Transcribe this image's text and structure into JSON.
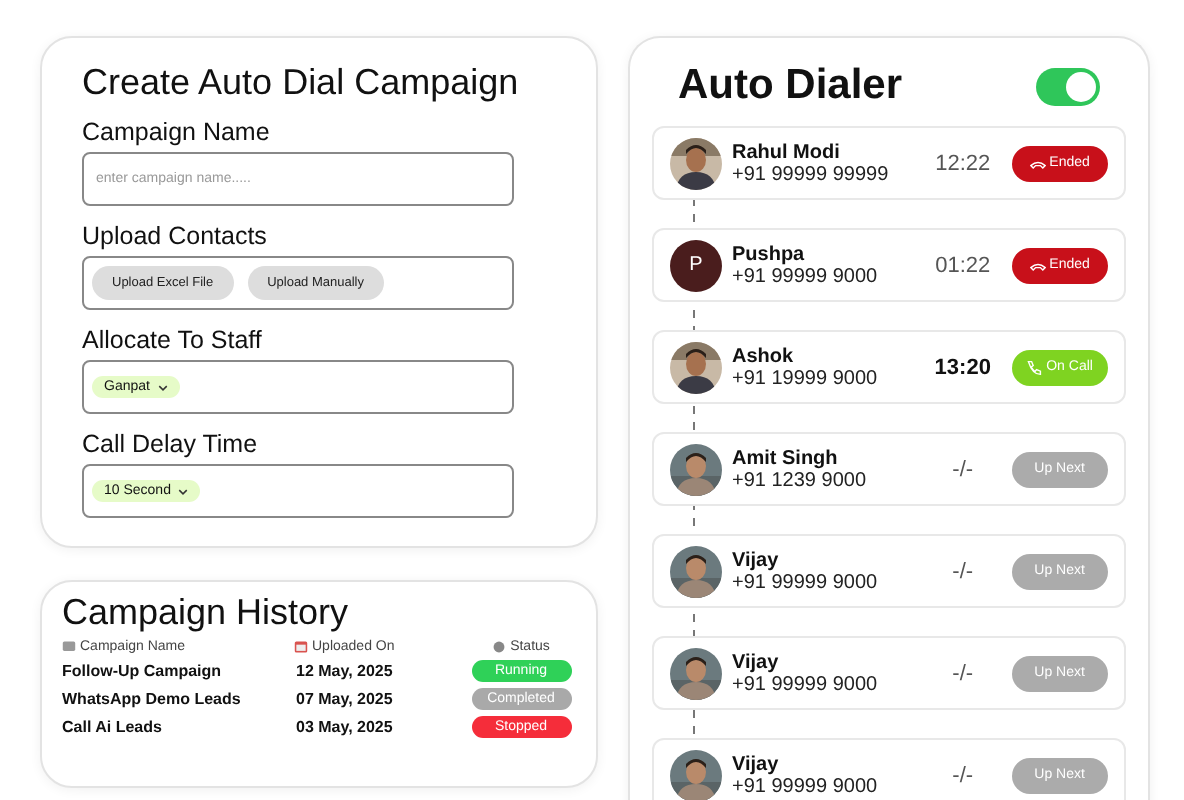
{
  "create_campaign": {
    "title": "Create Auto Dial Campaign",
    "fields": [
      {
        "kind": "text",
        "label": "Campaign Name",
        "placeholder": "enter campaign name....."
      },
      {
        "kind": "buttons",
        "label": "Upload Contacts",
        "buttons": [
          "Upload Excel File",
          "Upload Manually"
        ]
      },
      {
        "kind": "select",
        "label": "Allocate To Staff",
        "value": "Ganpat"
      },
      {
        "kind": "select",
        "label": "Call Delay Time",
        "value": "10 Second"
      }
    ]
  },
  "campaign_history": {
    "title": "Campaign History",
    "columns": [
      "Campaign Name",
      "Uploaded On",
      "Status"
    ],
    "rows": [
      {
        "name": "Follow-Up Campaign",
        "date": "12 May, 2025",
        "status": "Running",
        "kind": "running"
      },
      {
        "name": "WhatsApp Demo Leads",
        "date": "07 May, 2025",
        "status": "Completed",
        "kind": "completed"
      },
      {
        "name": "Call Ai Leads",
        "date": "03 May, 2025",
        "status": "Stopped",
        "kind": "stopped"
      }
    ]
  },
  "auto_dialer": {
    "title": "Auto Dialer",
    "toggle": {
      "on": true
    },
    "calls": [
      {
        "name": "Rahul Modi",
        "phone": "+91 99999 99999",
        "time": "12:22",
        "status": "Ended",
        "kind": "ended"
      },
      {
        "name": "Pushpa",
        "phone": "+91 99999 9000",
        "time": "01:22",
        "status": "Ended",
        "kind": "ended",
        "avatar": {
          "kind": "letter",
          "letter": "P"
        }
      },
      {
        "name": "Ashok",
        "phone": "+91 19999 9000",
        "time": "13:20",
        "status": "On Call",
        "kind": "oncall"
      },
      {
        "name": "Amit Singh",
        "phone": "+91 1239 9000",
        "time": "-/-",
        "status": "Up Next",
        "kind": "next"
      },
      {
        "name": "Vijay",
        "phone": "+91 99999 9000",
        "time": "-/-",
        "status": "Up Next",
        "kind": "next"
      },
      {
        "name": "Vijay",
        "phone": "+91 99999 9000",
        "time": "-/-",
        "status": "Up Next",
        "kind": "next"
      },
      {
        "name": "Vijay",
        "phone": "+91 99999 9000",
        "time": "-/-",
        "status": "Up Next",
        "kind": "next"
      }
    ]
  }
}
